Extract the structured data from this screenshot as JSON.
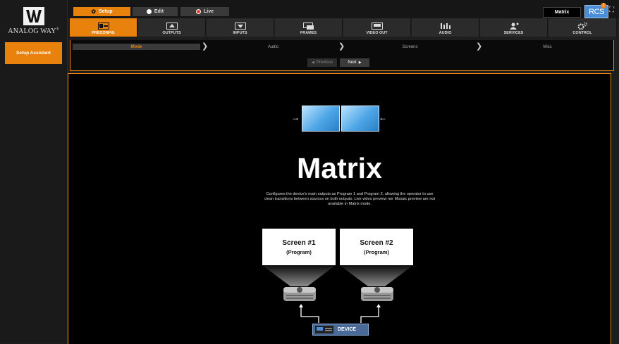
{
  "brand": {
    "logo_text": "ANALOG WAY",
    "logo_reg": "®"
  },
  "modes": [
    {
      "label": "Setup",
      "active": true
    },
    {
      "label": "Edit",
      "active": false
    },
    {
      "label": "Live",
      "active": false
    }
  ],
  "preset": {
    "label": "Matrix"
  },
  "rcs": {
    "label": "RCS",
    "badge": "2"
  },
  "nav": [
    {
      "label": "PRECONFIG",
      "active": true,
      "icon": "preconfig-icon"
    },
    {
      "label": "OUTPUTS",
      "active": false,
      "icon": "outputs-icon"
    },
    {
      "label": "INPUTS",
      "active": false,
      "icon": "inputs-icon"
    },
    {
      "label": "FRAMES",
      "active": false,
      "icon": "frames-icon"
    },
    {
      "label": "VIDEO OUT",
      "active": false,
      "icon": "video-out-icon"
    },
    {
      "label": "AUDIO",
      "active": false,
      "icon": "audio-icon"
    },
    {
      "label": "SERVICES",
      "active": false,
      "icon": "services-icon"
    },
    {
      "label": "CONTROL",
      "active": false,
      "icon": "control-icon"
    }
  ],
  "sidebar": {
    "items": [
      {
        "label": "Setup Assistant",
        "active": true
      }
    ]
  },
  "wizard": {
    "steps": [
      {
        "label": "Mode",
        "active": true
      },
      {
        "label": "Audio",
        "active": false
      },
      {
        "label": "Screens",
        "active": false
      },
      {
        "label": "Misc",
        "active": false
      }
    ],
    "previous_label": "Previous",
    "next_label": "Next"
  },
  "main": {
    "title": "Matrix",
    "description": "Configures the device's main outputs as Program 1 and Program 2, allowing the operator to use clean transitions between sources on both outputs.  Live video preview nor Mosaic preview are not available in Matrix mode.",
    "screens": [
      {
        "name": "Screen #1",
        "role": "(Program)"
      },
      {
        "name": "Screen #2",
        "role": "(Program)"
      }
    ],
    "device_label": "DEVICE"
  },
  "colors": {
    "accent": "#e8820c",
    "screen_blue": "#4fa6e6",
    "device_blue": "#4a6a99"
  }
}
